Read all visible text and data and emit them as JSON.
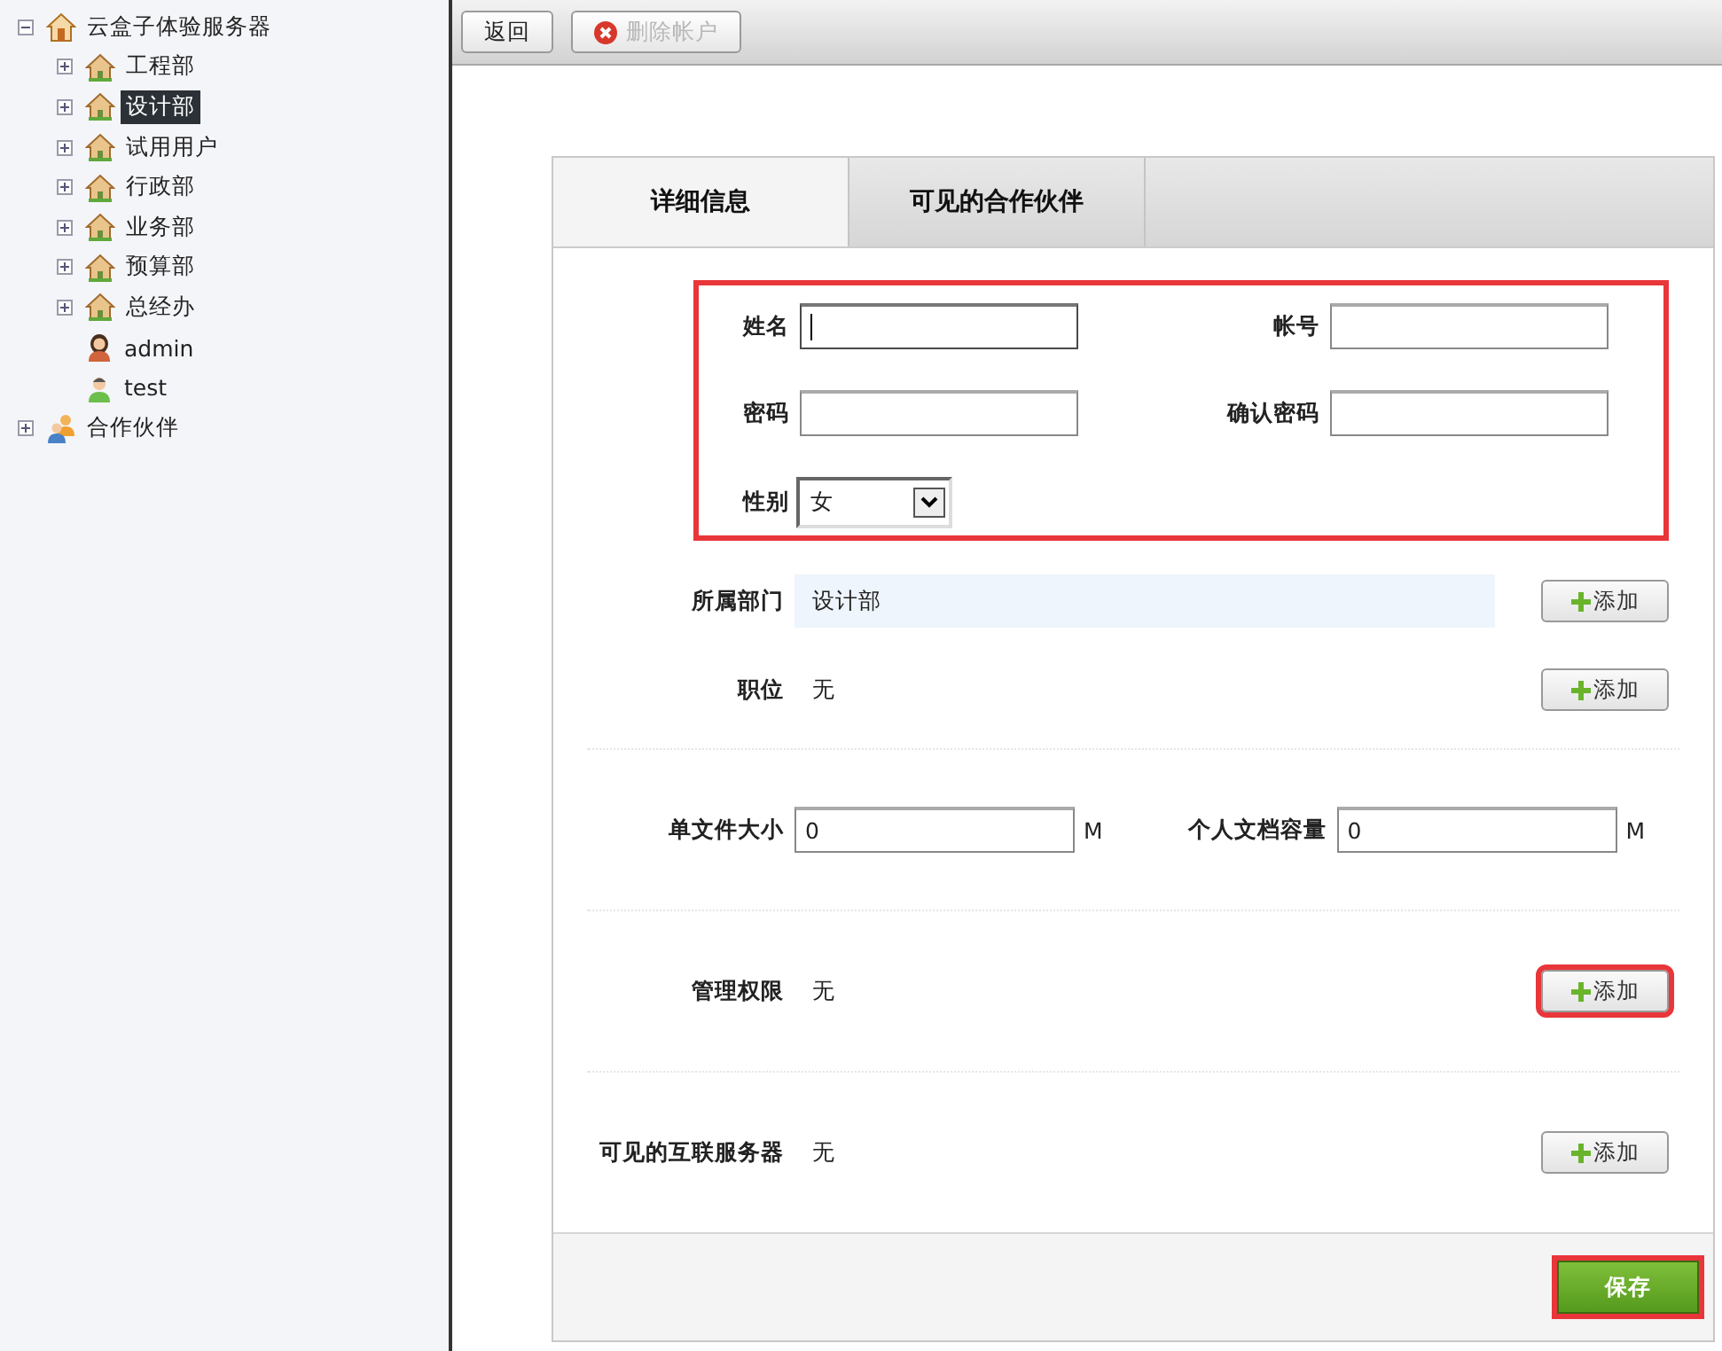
{
  "tree": {
    "label": "云盒子体验服务器",
    "kind": "server",
    "expanded": true,
    "selected": false,
    "children": [
      {
        "label": "工程部",
        "kind": "group",
        "expanded": false,
        "selected": false
      },
      {
        "label": "设计部",
        "kind": "group",
        "expanded": false,
        "selected": true
      },
      {
        "label": "试用用户",
        "kind": "group",
        "expanded": false,
        "selected": false
      },
      {
        "label": "行政部",
        "kind": "group",
        "expanded": false,
        "selected": false
      },
      {
        "label": "业务部",
        "kind": "group",
        "expanded": false,
        "selected": false
      },
      {
        "label": "预算部",
        "kind": "group",
        "expanded": false,
        "selected": false
      },
      {
        "label": "总经办",
        "kind": "group",
        "expanded": false,
        "selected": false
      },
      {
        "label": "admin",
        "kind": "user_female",
        "selected": false
      },
      {
        "label": "test",
        "kind": "user_male",
        "selected": false
      }
    ]
  },
  "tree_extra": [
    {
      "label": "合作伙伴",
      "kind": "partners",
      "expanded": false,
      "selected": false
    }
  ],
  "toolbar": [
    {
      "label": "返回",
      "kind": "plain",
      "disabled": false
    },
    {
      "label": "删除帐户",
      "kind": "delete",
      "disabled": true
    }
  ],
  "tabs": [
    {
      "label": "详细信息",
      "selected": true
    },
    {
      "label": "可见的合作伙伴",
      "selected": false
    }
  ],
  "account_box": {
    "highlighted": true,
    "fields": [
      {
        "label": "姓名",
        "focused": true
      },
      {
        "label": "帐号",
        "focused": false
      },
      {
        "label": "密码",
        "focused": false
      },
      {
        "label": "确认密码",
        "focused": false
      }
    ],
    "gender": {
      "label": "性别",
      "value": "女"
    }
  },
  "assignments": [
    {
      "label": "所属部门",
      "value": "设计部",
      "shaded": true,
      "button": "添加",
      "highlighted": false
    },
    {
      "label": "职位",
      "value": "无",
      "shaded": false,
      "button": "添加",
      "highlighted": false
    }
  ],
  "quotas": [
    {
      "label": "单文件大小",
      "value": "0",
      "unit": "M"
    },
    {
      "label": "个人文档容量",
      "value": "0",
      "unit": "M"
    }
  ],
  "extra_sections": [
    {
      "label": "管理权限",
      "value": "无",
      "button": "添加",
      "highlighted": true
    },
    {
      "label": "可见的互联服务器",
      "value": "无",
      "button": "添加",
      "highlighted": false
    }
  ],
  "save_button": {
    "label": "保存",
    "highlighted": true
  }
}
